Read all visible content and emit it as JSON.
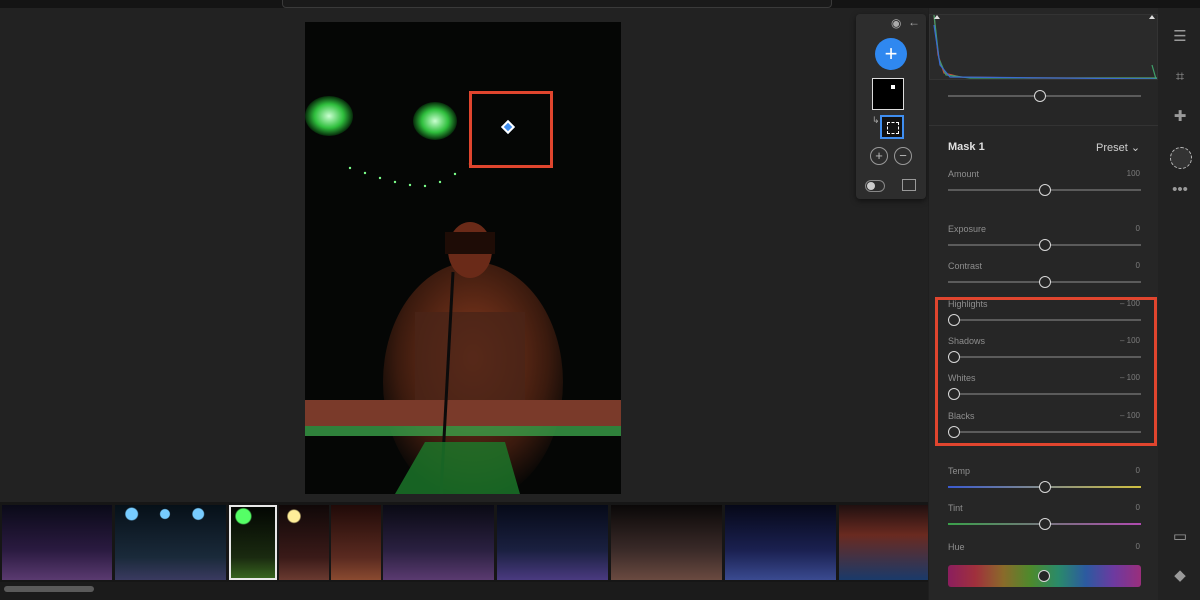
{
  "mask_popup": {
    "add_symbol": "+",
    "add_circle_symbol": "+",
    "subtract_circle_symbol": "−",
    "icons": [
      "eye-icon",
      "back-arrow-icon",
      "toggle-icon",
      "overlay-icon"
    ]
  },
  "mask_panel": {
    "title": "Mask 1",
    "preset_label": "Preset",
    "sliders": [
      {
        "label": "Amount",
        "value": "100",
        "level": 0.5
      },
      {
        "label": "Exposure",
        "value": "0",
        "level": 0.5
      },
      {
        "label": "Contrast",
        "value": "0",
        "level": 0.5
      },
      {
        "label": "Highlights",
        "value": "– 100",
        "level": 0.0
      },
      {
        "label": "Shadows",
        "value": "– 100",
        "level": 0.0
      },
      {
        "label": "Whites",
        "value": "– 100",
        "level": 0.0
      },
      {
        "label": "Blacks",
        "value": "– 100",
        "level": 0.0
      },
      {
        "label": "Temp",
        "value": "0",
        "level": 0.5
      },
      {
        "label": "Tint",
        "value": "0",
        "level": 0.5
      },
      {
        "label": "Hue",
        "value": "0",
        "level": 0.5
      }
    ],
    "top_slider_level": 0.5
  },
  "filmstrip": {
    "selected_index": 2,
    "thumbnails": 9
  },
  "right_toolbar_icons": [
    "sliders-icon",
    "crop-icon",
    "healing-icon",
    "mask-icon",
    "more-icon",
    "comment-icon",
    "tag-icon"
  ],
  "colors": {
    "accent": "#2f88f0",
    "highlight": "#e0452e"
  }
}
